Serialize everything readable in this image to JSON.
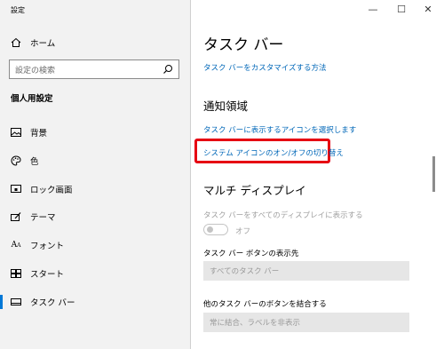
{
  "window": {
    "title": "設定",
    "controls": {
      "minimize": "—",
      "maximize": "☐",
      "close": "✕"
    }
  },
  "sidebar": {
    "home_label": "ホーム",
    "search_placeholder": "設定の検索",
    "section_title": "個人用設定",
    "items": [
      {
        "label": "背景",
        "icon": "background-icon"
      },
      {
        "label": "色",
        "icon": "color-palette-icon"
      },
      {
        "label": "ロック画面",
        "icon": "lock-screen-icon"
      },
      {
        "label": "テーマ",
        "icon": "theme-brush-icon"
      },
      {
        "label": "フォント",
        "icon": "font-icon"
      },
      {
        "label": "スタート",
        "icon": "start-icon"
      },
      {
        "label": "タスク バー",
        "icon": "taskbar-icon",
        "selected": true
      }
    ]
  },
  "main": {
    "title": "タスク バー",
    "customize_link": "タスク バーをカスタマイズする方法",
    "notification_area": {
      "heading": "通知領域",
      "select_icons_link": "タスク バーに表示するアイコンを選択します",
      "system_icons_link": "システム アイコンのオン/オフの切り替え"
    },
    "multi_display": {
      "heading": "マルチ ディスプレイ",
      "show_on_all_label": "タスク バーをすべてのディスプレイに表示する",
      "toggle_state": "オフ",
      "show_buttons_label": "タスク バー ボタンの表示先",
      "show_buttons_value": "すべてのタスク バー",
      "combine_label": "他のタスク バーのボタンを結合する",
      "combine_value": "常に結合、ラベルを非表示"
    }
  },
  "colors": {
    "link": "#0067b8",
    "accent": "#0078d7",
    "highlight_box": "#e60012",
    "sidebar_bg": "#f2f2f2"
  }
}
